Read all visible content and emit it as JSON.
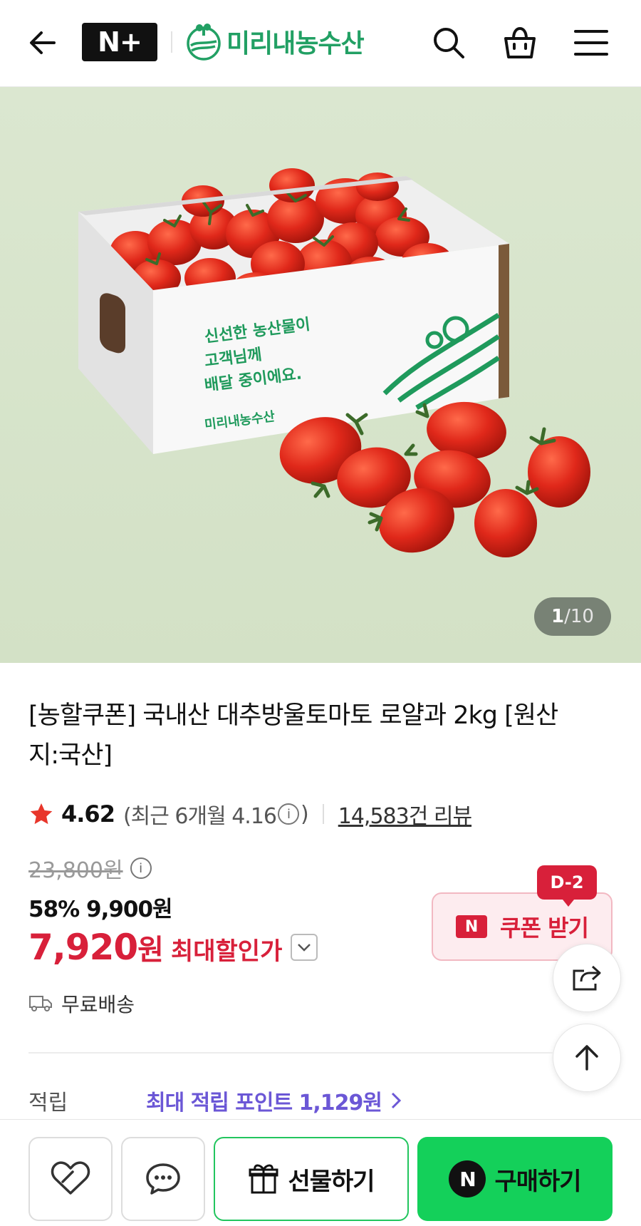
{
  "header": {
    "badge": "N+",
    "store_name": "미리내농수산"
  },
  "product_image": {
    "box_text_1": "신선한 농산물이",
    "box_text_2": "고객님께",
    "box_text_3": "배달 중이에요.",
    "box_brand": "미리내농수산",
    "counter_current": "1",
    "counter_sep": "/",
    "counter_total": "10"
  },
  "product": {
    "title": "[농할쿠폰] 국내산 대추방울토마토 로얄과 2kg [원산지:국산]",
    "rating": "4.62",
    "recent_rating_prefix": "(최근 6개월 4.16",
    "recent_rating_suffix": ")",
    "review_count": "14,583건 리뷰",
    "original_price": "23,800원",
    "discount_price_line": "58% 9,900원",
    "final_price": "7,920",
    "final_price_unit": "원",
    "final_price_label": "최대할인가",
    "coupon_label": "쿠폰 받기",
    "coupon_badge": "N",
    "coupon_dday": "D-2",
    "shipping": "무료배송",
    "points_label": "적립",
    "points_value": "최대 적립 포인트 1,129원"
  },
  "bottom_bar": {
    "gift_label": "선물하기",
    "buy_label": "구매하기",
    "buy_badge": "N"
  },
  "colors": {
    "brand_green": "#22a064",
    "price_red": "#d8203a",
    "points_purple": "#6b57d6",
    "buy_green": "#14d05a"
  }
}
